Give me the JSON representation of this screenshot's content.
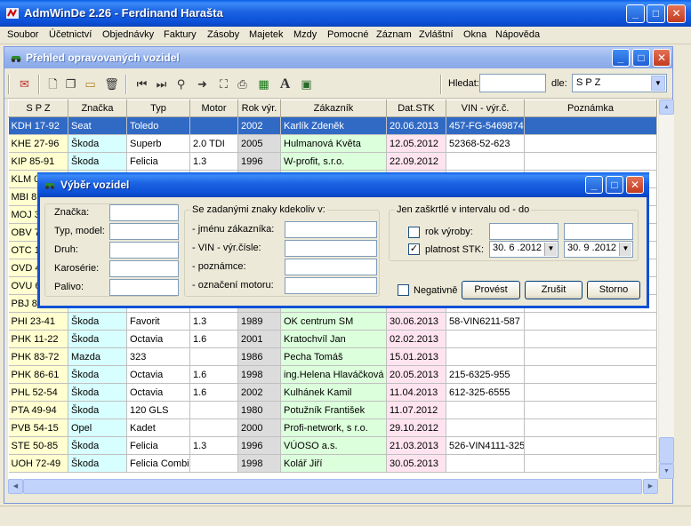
{
  "app": {
    "title": "AdmWinDe 2.26 - Ferdinand Harašta",
    "menu": [
      "Soubor",
      "Účetnictví",
      "Objednávky",
      "Faktury",
      "Zásoby",
      "Majetek",
      "Mzdy",
      "Pomocné",
      "Záznam",
      "Zvláštní",
      "Okna",
      "Nápověda"
    ]
  },
  "child": {
    "title": "Přehled opravovaných vozidel",
    "search_label": "Hledat:",
    "search_value": "",
    "by_label": "dle:",
    "by_value": "S P Z",
    "toolbar_icons": [
      "print-preview-icon",
      "new-document-icon",
      "copy-icon",
      "open-folder-icon",
      "delete-icon",
      "first-record-icon",
      "last-record-icon",
      "search-icon",
      "next-icon",
      "select-area-icon",
      "printer-icon",
      "excel-export-icon",
      "font-icon",
      "calculator-icon"
    ]
  },
  "grid": {
    "columns": [
      "S P Z",
      "Značka",
      "Typ",
      "Motor",
      "Rok výr.",
      "Zákazník",
      "Dat.STK",
      "VIN - výr.č.",
      "Poznámka"
    ],
    "rows": [
      {
        "spz": "KDH 17-92",
        "brand": "Seat",
        "type": "Toledo",
        "engine": "",
        "year": "2002",
        "customer": "Karlík Zdeněk",
        "stk": "20.06.2013",
        "vin": "457-FG-5469874",
        "note": "",
        "selected": true
      },
      {
        "spz": "KHE 27-96",
        "brand": "Škoda",
        "type": "Superb",
        "engine": "2.0 TDI",
        "year": "2005",
        "customer": "Hulmanová Květa",
        "stk": "12.05.2012",
        "vin": "52368-52-623",
        "note": ""
      },
      {
        "spz": "KIP 85-91",
        "brand": "Škoda",
        "type": "Felicia",
        "engine": "1.3",
        "year": "1996",
        "customer": "W-profit, s.r.o.",
        "stk": "22.09.2012",
        "vin": "",
        "note": ""
      },
      {
        "spz": "KLM 0",
        "brand": "",
        "type": "",
        "engine": "",
        "year": "",
        "customer": "",
        "stk": "",
        "vin": "",
        "note": ""
      },
      {
        "spz": "MBI 8",
        "brand": "",
        "type": "",
        "engine": "",
        "year": "",
        "customer": "",
        "stk": "",
        "vin": "",
        "note": ""
      },
      {
        "spz": "MOJ 3",
        "brand": "",
        "type": "",
        "engine": "",
        "year": "",
        "customer": "",
        "stk": "",
        "vin": "",
        "note": ""
      },
      {
        "spz": "OBV 7",
        "brand": "",
        "type": "",
        "engine": "",
        "year": "",
        "customer": "",
        "stk": "",
        "vin": "",
        "note": ""
      },
      {
        "spz": "OTC 1",
        "brand": "",
        "type": "",
        "engine": "",
        "year": "",
        "customer": "",
        "stk": "",
        "vin": "",
        "note": ""
      },
      {
        "spz": "OVD 4",
        "brand": "",
        "type": "",
        "engine": "",
        "year": "",
        "customer": "",
        "stk": "",
        "vin": "",
        "note": ""
      },
      {
        "spz": "OVU 6",
        "brand": "",
        "type": "",
        "engine": "",
        "year": "",
        "customer": "",
        "stk": "",
        "vin": "",
        "note": ""
      },
      {
        "spz": "PBJ 8",
        "brand": "",
        "type": "",
        "engine": "",
        "year": "",
        "customer": "",
        "stk": "",
        "vin": "",
        "note": ""
      },
      {
        "spz": "PHI 23-41",
        "brand": "Škoda",
        "type": "Favorit",
        "engine": "1.3",
        "year": "1989",
        "customer": "OK centrum SM",
        "stk": "30.06.2013",
        "vin": "58-VIN6211-587",
        "note": ""
      },
      {
        "spz": "PHK 11-22",
        "brand": "Škoda",
        "type": "Octavia",
        "engine": "1.6",
        "year": "2001",
        "customer": "Kratochvíl Jan",
        "stk": "02.02.2013",
        "vin": "",
        "note": ""
      },
      {
        "spz": "PHK 83-72",
        "brand": "Mazda",
        "type": "323",
        "engine": "",
        "year": "1986",
        "customer": "Pecha Tomáš",
        "stk": "15.01.2013",
        "vin": "",
        "note": ""
      },
      {
        "spz": "PHK 86-61",
        "brand": "Škoda",
        "type": "Octavia",
        "engine": "1.6",
        "year": "1998",
        "customer": "ing.Helena Hlaváčková",
        "stk": "20.05.2013",
        "vin": "215-6325-955",
        "note": ""
      },
      {
        "spz": "PHL 52-54",
        "brand": "Škoda",
        "type": "Octavia",
        "engine": "1.6",
        "year": "2002",
        "customer": "Kulhánek Kamil",
        "stk": "11.04.2013",
        "vin": "612-325-6555",
        "note": ""
      },
      {
        "spz": "PTA 49-94",
        "brand": "Škoda",
        "type": "120 GLS",
        "engine": "",
        "year": "1980",
        "customer": "Potužník František",
        "stk": "11.07.2012",
        "vin": "",
        "note": ""
      },
      {
        "spz": "PVB 54-15",
        "brand": "Opel",
        "type": "Kadet",
        "engine": "",
        "year": "2000",
        "customer": "Profi-network, s r.o.",
        "stk": "29.10.2012",
        "vin": "",
        "note": ""
      },
      {
        "spz": "STE 50-85",
        "brand": "Škoda",
        "type": "Felicia",
        "engine": "1.3",
        "year": "1996",
        "customer": "VÚOSO a.s.",
        "stk": "21.03.2013",
        "vin": "526-VIN4111-325",
        "note": ""
      },
      {
        "spz": "UOH 72-49",
        "brand": "Škoda",
        "type": "Felicia Combi",
        "engine": "",
        "year": "1998",
        "customer": "Kolář Jiří",
        "stk": "30.05.2013",
        "vin": "",
        "note": ""
      }
    ]
  },
  "dialog": {
    "title": "Výběr vozidel",
    "left_fields": [
      {
        "label": "Značka:",
        "value": ""
      },
      {
        "label": "Typ, model:",
        "value": ""
      },
      {
        "label": "Druh:",
        "value": ""
      },
      {
        "label": "Karosérie:",
        "value": ""
      },
      {
        "label": "Palivo:",
        "value": ""
      }
    ],
    "mid_group_title": "Se zadanými znaky kdekoliv v:",
    "mid_fields": [
      {
        "label": "- jménu zákazníka:",
        "value": ""
      },
      {
        "label": "- VIN - výr.čísle:",
        "value": ""
      },
      {
        "label": "- poznámce:",
        "value": ""
      },
      {
        "label": "- označení motoru:",
        "value": ""
      }
    ],
    "right_group_title": "Jen zaškrtlé v intervalu od - do",
    "year_label": "rok výroby:",
    "year_checked": false,
    "year_from": "",
    "year_to": "",
    "stk_label": "platnost STK:",
    "stk_checked": true,
    "stk_from": "30. 6 .2012",
    "stk_to": "30. 9 .2012",
    "negative_label": "Negativně",
    "negative_checked": false,
    "btn_run": "Provést",
    "btn_cancel": "Zrušit",
    "btn_storno": "Storno"
  }
}
